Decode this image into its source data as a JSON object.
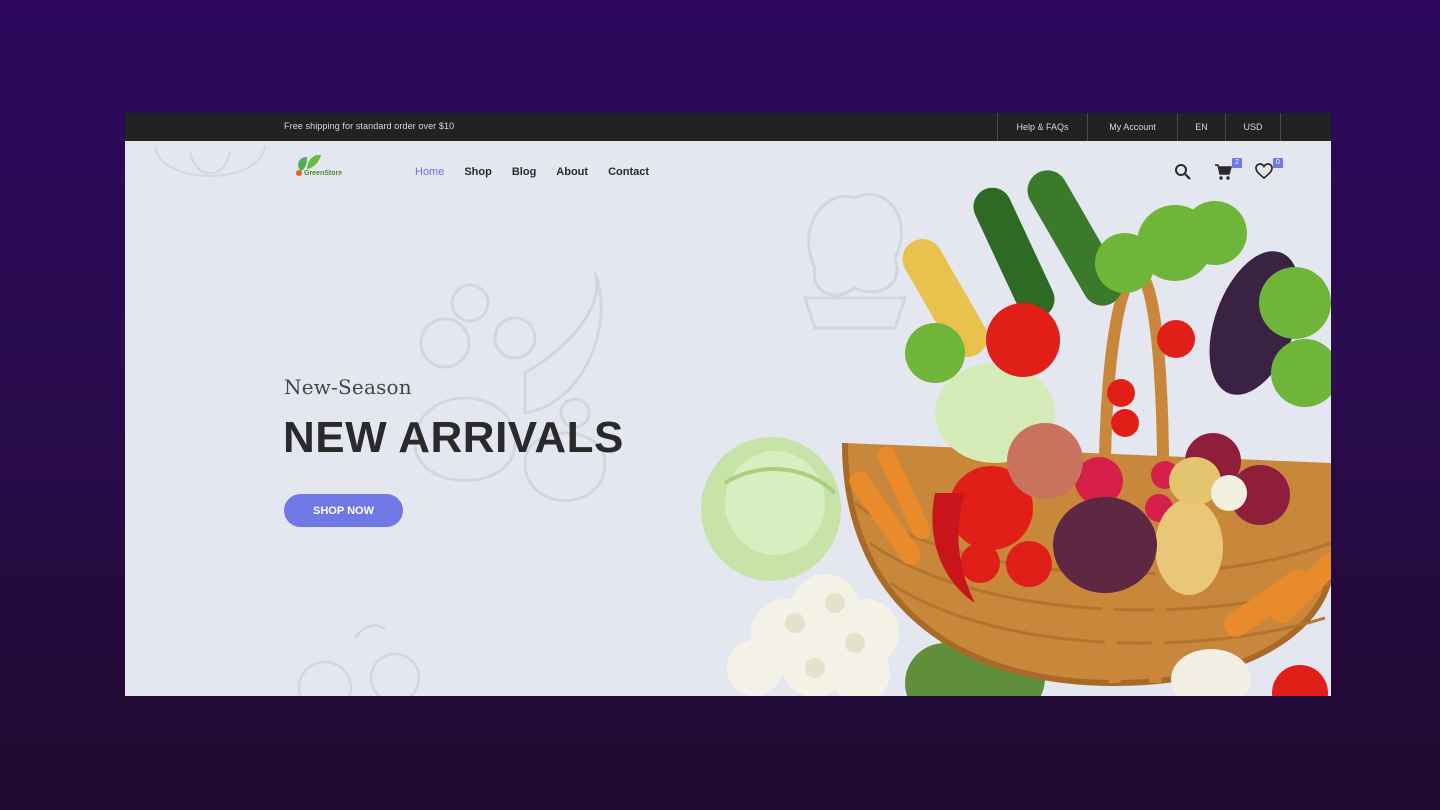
{
  "topbar": {
    "shipping_text": "Free shipping for standard order over $10",
    "links": [
      "Help & FAQs",
      "My Account",
      "EN",
      "USD"
    ]
  },
  "header": {
    "logo_text": "GreenStore",
    "nav": [
      {
        "label": "Home",
        "active": true
      },
      {
        "label": "Shop",
        "active": false
      },
      {
        "label": "Blog",
        "active": false
      },
      {
        "label": "About",
        "active": false
      },
      {
        "label": "Contact",
        "active": false
      }
    ],
    "icons": [
      "search-icon",
      "cart-icon",
      "heart-icon"
    ],
    "cart_count": "2",
    "wishlist_count": "0"
  },
  "hero": {
    "subtitle": "New-Season",
    "title": "NEW ARRIVALS",
    "cta_label": "SHOP NOW"
  },
  "colors": {
    "accent": "#7078e6",
    "topbar_bg": "#222222",
    "page_bg": "#e4e7ef"
  }
}
